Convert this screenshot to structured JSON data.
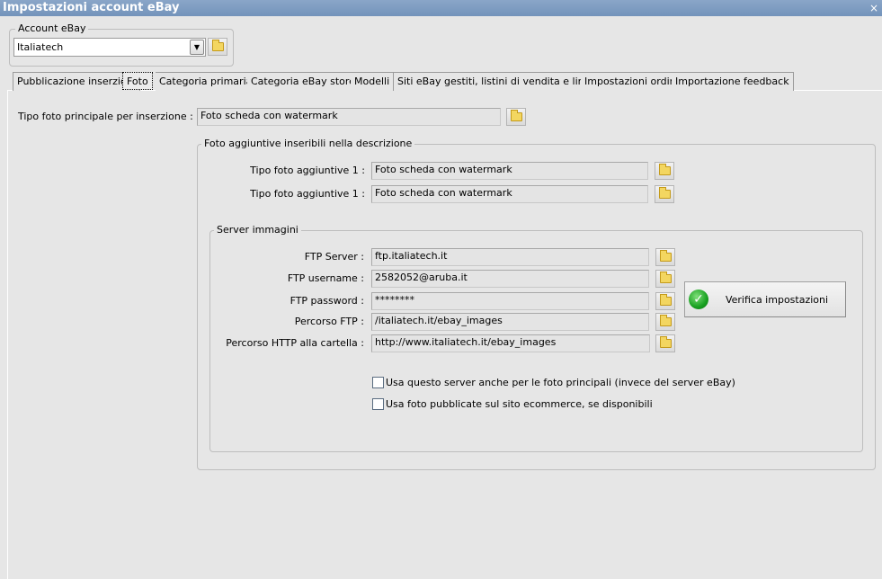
{
  "window": {
    "title": "Impostazioni account eBay",
    "close": "×"
  },
  "account": {
    "legend": "Account eBay",
    "value": "Italiatech"
  },
  "tabs": [
    "Pubblicazione inserzioni",
    "Foto",
    "Categoria primaria",
    "Categoria eBay store",
    "Modelli",
    "Siti eBay gestiti, listini di vendita e lingue",
    "Impostazioni ordini",
    "Importazione feedback"
  ],
  "main": {
    "label": "Tipo foto principale per inserzione :",
    "value": "Foto scheda con watermark"
  },
  "extra": {
    "legend": "Foto aggiuntive inseribili nella descrizione",
    "rows": [
      {
        "label": "Tipo foto aggiuntive 1 :",
        "value": "Foto scheda con watermark"
      },
      {
        "label": "Tipo foto aggiuntive 1 :",
        "value": "Foto scheda con watermark"
      }
    ]
  },
  "server": {
    "legend": "Server immagini",
    "rows": [
      {
        "label": "FTP Server :",
        "value": "ftp.italiatech.it"
      },
      {
        "label": "FTP username :",
        "value": "2582052@aruba.it"
      },
      {
        "label": "FTP password :",
        "value": "********"
      },
      {
        "label": "Percorso FTP :",
        "value": "/italiatech.it/ebay_images"
      },
      {
        "label": "Percorso HTTP alla cartella :",
        "value": "http://www.italiatech.it/ebay_images"
      }
    ],
    "verify": "Verifica impostazioni",
    "checks": [
      {
        "label": "Usa questo server anche per le foto principali (invece del server eBay)",
        "checked": false
      },
      {
        "label": "Usa foto pubblicate sul sito ecommerce, se disponibili",
        "checked": false
      }
    ]
  }
}
